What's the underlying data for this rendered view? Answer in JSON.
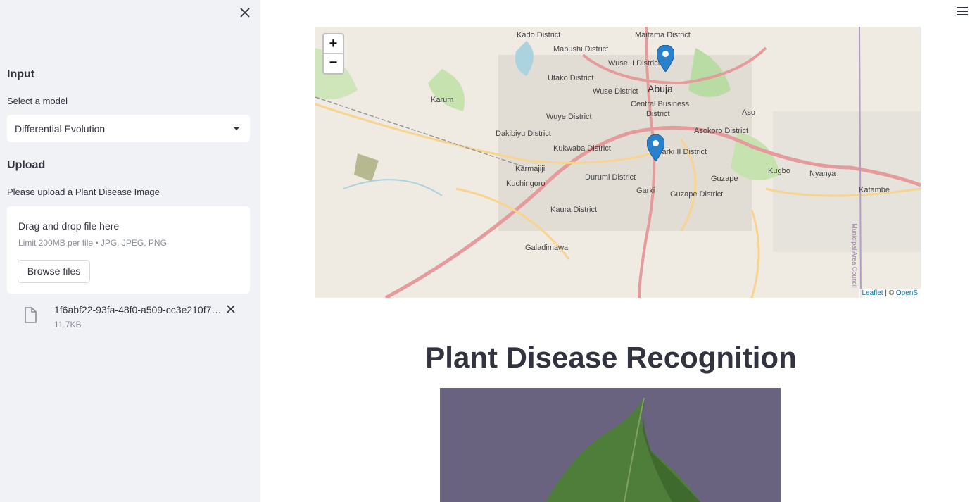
{
  "sidebar": {
    "input_heading": "Input",
    "select_label": "Select a model",
    "model_value": "Differential Evolution",
    "upload_heading": "Upload",
    "upload_label": "Please upload a Plant Disease Image",
    "dropzone": {
      "title": "Drag and drop file here",
      "limit": "Limit 200MB per file • JPG, JPEG, PNG",
      "browse_label": "Browse files"
    },
    "uploaded_file": {
      "name": "1f6abf22-93fa-48f0-a509-cc3e210f7…",
      "size": "11.7KB"
    }
  },
  "map": {
    "zoom_in": "+",
    "zoom_out": "−",
    "attribution_link": "Leaflet",
    "attribution_sep": " | © ",
    "attribution_osm": "OpenS",
    "labels": {
      "kado": "Kado District",
      "maitama": "Maitama District",
      "mabushi": "Mabushi District",
      "wuse2": "Wuse II District",
      "utako": "Utako District",
      "wuse": "Wuse District",
      "abuja": "Abuja",
      "karum": "Karum",
      "cbd1": "Central Business",
      "cbd2": "District",
      "wuye": "Wuye District",
      "asokoro": "Asokoro District",
      "aso": "Aso",
      "dakibiyu": "Dakibiyu District",
      "kukwaba": "Kukwaba District",
      "garki2": "Garki II District",
      "karmajiji": "Karmajiji",
      "kugbo": "Kugbo",
      "nyanya": "Nyanya",
      "guzape": "Guzape",
      "durumi": "Durumi District",
      "kuchingoro": "Kuchingoro",
      "garki": "Garki",
      "guzape_d": "Guzape District",
      "katambe": "Katambe",
      "kaura": "Kaura District",
      "galadimawa": "Galadimawa",
      "municipal": "Municipal Area Council"
    }
  },
  "main": {
    "title": "Plant Disease Recognition"
  }
}
